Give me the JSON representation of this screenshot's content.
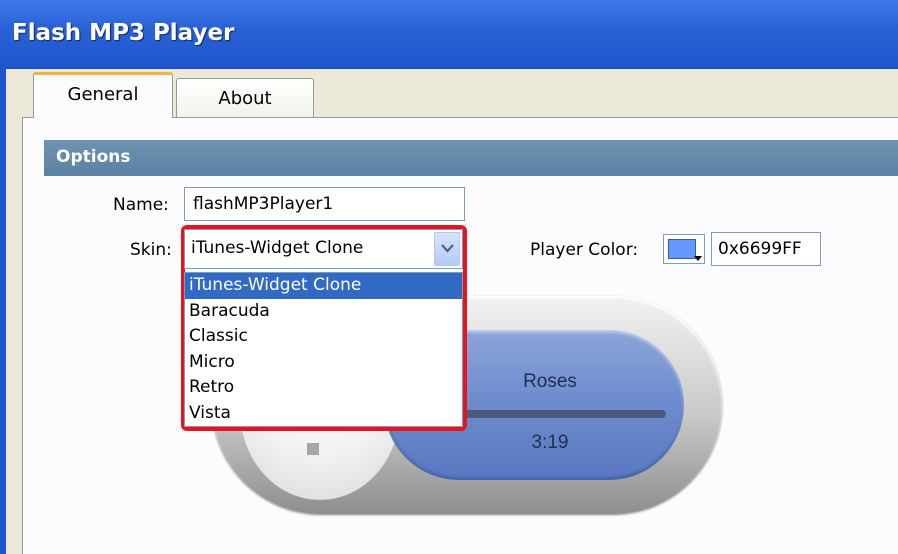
{
  "window": {
    "title": "Flash MP3 Player"
  },
  "tabs": [
    {
      "label": "General",
      "active": true
    },
    {
      "label": "About",
      "active": false
    }
  ],
  "options": {
    "header": "Options",
    "name_label": "Name:",
    "name_value": "flashMP3Player1",
    "skin_label": "Skin:",
    "skin_value": "iTunes-Widget Clone",
    "skin_options": [
      "iTunes-Widget Clone",
      "Baracuda",
      "Classic",
      "Micro",
      "Retro",
      "Vista"
    ],
    "player_color_label": "Player Color:",
    "player_color_value": "0x6699FF",
    "player_color_hex": "#6699ff"
  },
  "player_preview": {
    "track_title": "Roses",
    "track_time": "3:19"
  },
  "colors": {
    "titlebar": "#2a62d6",
    "selection": "#316ac5",
    "highlight_border": "#e8141c"
  }
}
